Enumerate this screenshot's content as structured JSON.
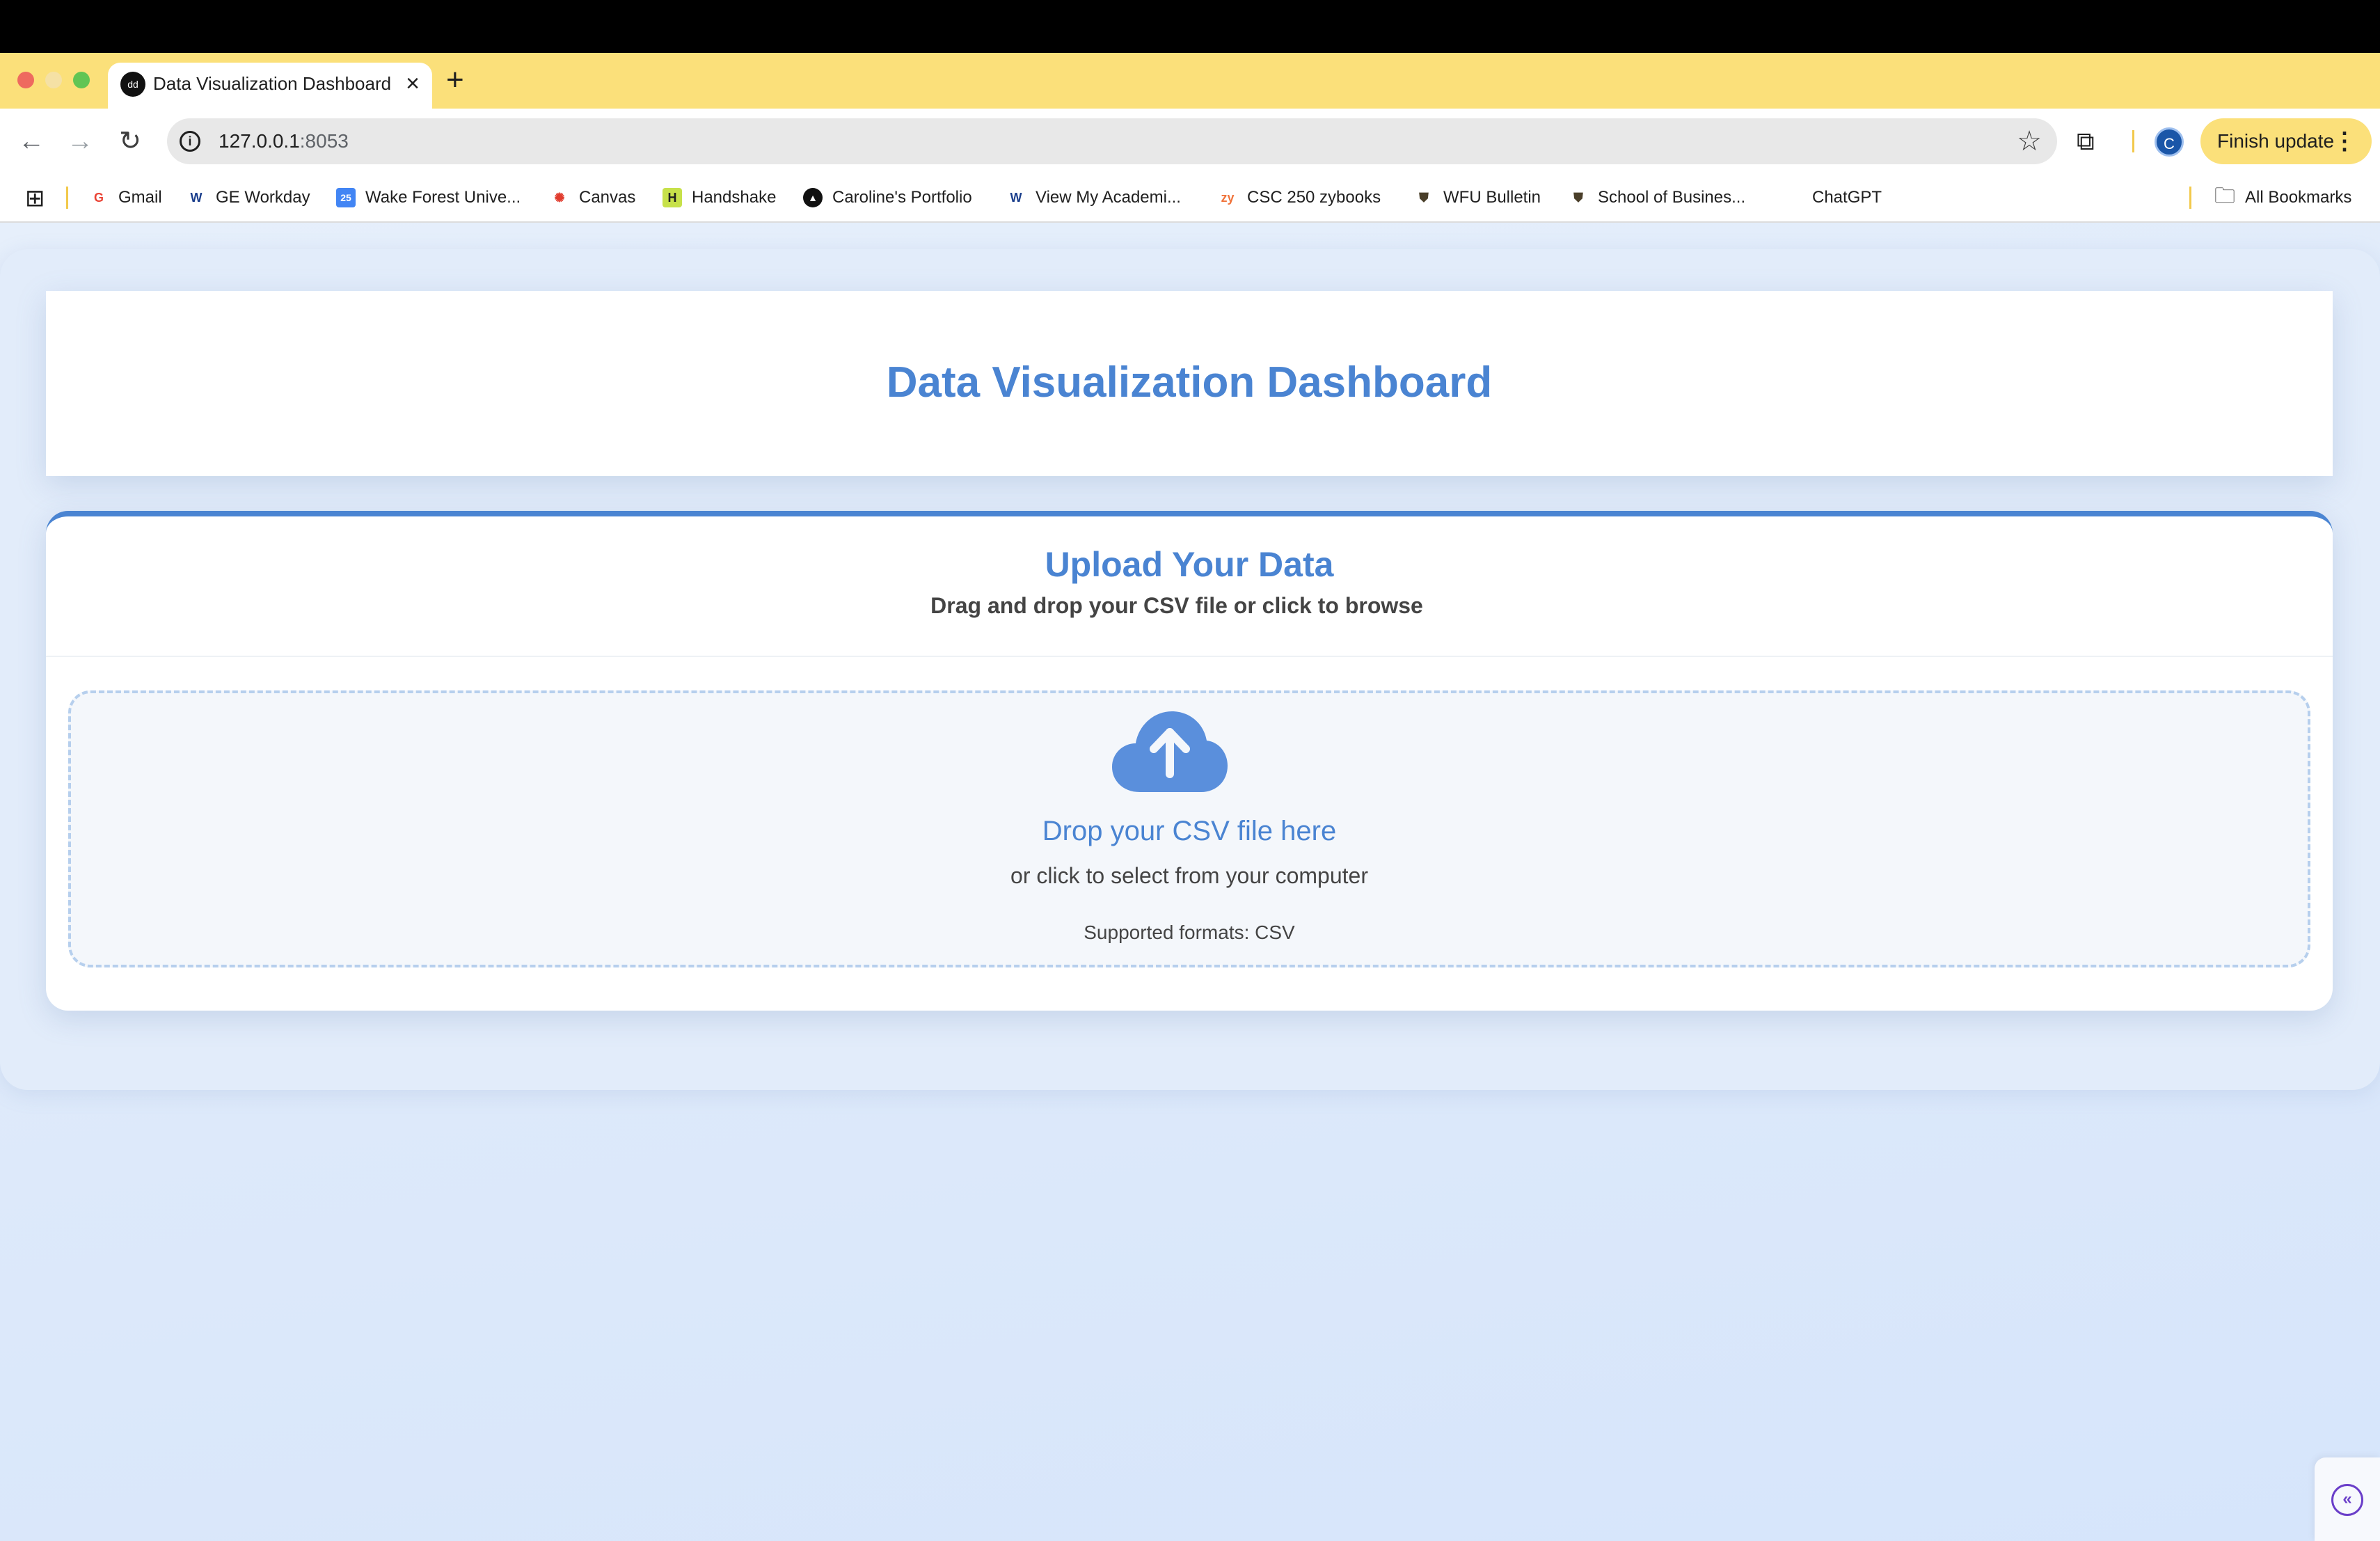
{
  "browser": {
    "tab_title": "Data Visualization Dashboard",
    "tab_favicon": "dd",
    "url_host": "127.0.0.1",
    "url_port": ":8053",
    "profile_initial": "C",
    "finish_update_label": "Finish update",
    "bookmarks": [
      {
        "label": "Gmail",
        "icon": "google-icon",
        "icon_text": "G",
        "color": "#ea4335"
      },
      {
        "label": "GE Workday",
        "icon": "workday-icon",
        "icon_text": "W",
        "color": "#1a3e8c"
      },
      {
        "label": "Wake Forest Unive...",
        "icon": "calendar-icon",
        "icon_text": "25",
        "color": "#4285f4"
      },
      {
        "label": "Canvas",
        "icon": "canvas-icon",
        "icon_text": "✺",
        "color": "#e13c2e"
      },
      {
        "label": "Handshake",
        "icon": "handshake-icon",
        "icon_text": "H",
        "color": "#c7e14a"
      },
      {
        "label": "Caroline's Portfolio",
        "icon": "portfolio-icon",
        "icon_text": "▲",
        "color": "#111111"
      },
      {
        "label": "View My Academi...",
        "icon": "workday-icon",
        "icon_text": "W",
        "color": "#1a3e8c"
      },
      {
        "label": "CSC 250 zybooks",
        "icon": "zybooks-icon",
        "icon_text": "zy",
        "color": "#f0743c"
      },
      {
        "label": "WFU Bulletin",
        "icon": "shield-icon",
        "icon_text": "⛊",
        "color": "#4a3f2a"
      },
      {
        "label": "School of Busines...",
        "icon": "shield-icon",
        "icon_text": "⛊",
        "color": "#4a3f2a"
      },
      {
        "label": "ChatGPT",
        "icon": "",
        "icon_text": "",
        "color": "#ffffff"
      }
    ],
    "all_bookmarks_label": "All Bookmarks"
  },
  "dashboard": {
    "title": "Data Visualization Dashboard",
    "upload": {
      "title": "Upload Your Data",
      "subtitle": "Drag and drop your CSV file or click to browse",
      "drop_title": "Drop your CSV file here",
      "drop_subtitle": "or click to select from your computer",
      "formats": "Supported formats: CSV"
    }
  },
  "colors": {
    "accent": "#4a84d2",
    "tab_strip": "#fbe07a",
    "page_bg": "#dbe8fa"
  }
}
